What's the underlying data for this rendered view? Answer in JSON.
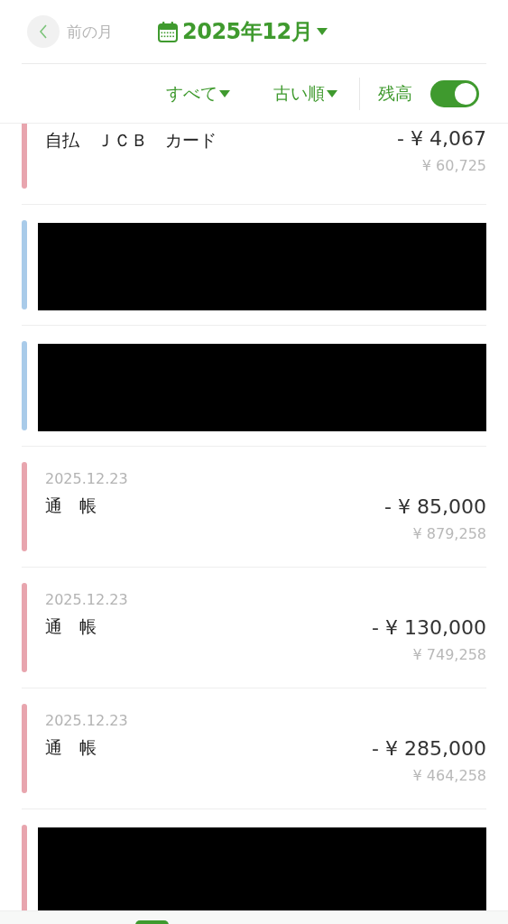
{
  "header": {
    "back_label": "前の月",
    "month": "2025年12月"
  },
  "filters": [
    {
      "label": "すべて"
    },
    {
      "label": "古い順"
    }
  ],
  "balance_toggle": {
    "label": "残高",
    "on": true
  },
  "rows": [
    {
      "kind": "entry",
      "color": "#e8a5ae",
      "title": "自払　ＪＣＢ　カード",
      "amount": "- ¥ 4,067",
      "balance": "¥ 60,725"
    },
    {
      "kind": "redacted",
      "color": "#a9cbe9"
    },
    {
      "kind": "redacted",
      "color": "#a9cbe9"
    },
    {
      "kind": "entry",
      "color": "#e8a5ae",
      "date": "2025.12.23",
      "title": "通　帳",
      "amount": "- ¥ 85,000",
      "balance": "¥ 879,258"
    },
    {
      "kind": "entry",
      "color": "#e8a5ae",
      "date": "2025.12.23",
      "title": "通　帳",
      "amount": "- ¥ 130,000",
      "balance": "¥ 749,258"
    },
    {
      "kind": "entry",
      "color": "#e8a5ae",
      "date": "2025.12.23",
      "title": "通　帳",
      "amount": "- ¥ 285,000",
      "balance": "¥ 464,258"
    },
    {
      "kind": "redacted",
      "color": "#e8a5ae"
    }
  ]
}
